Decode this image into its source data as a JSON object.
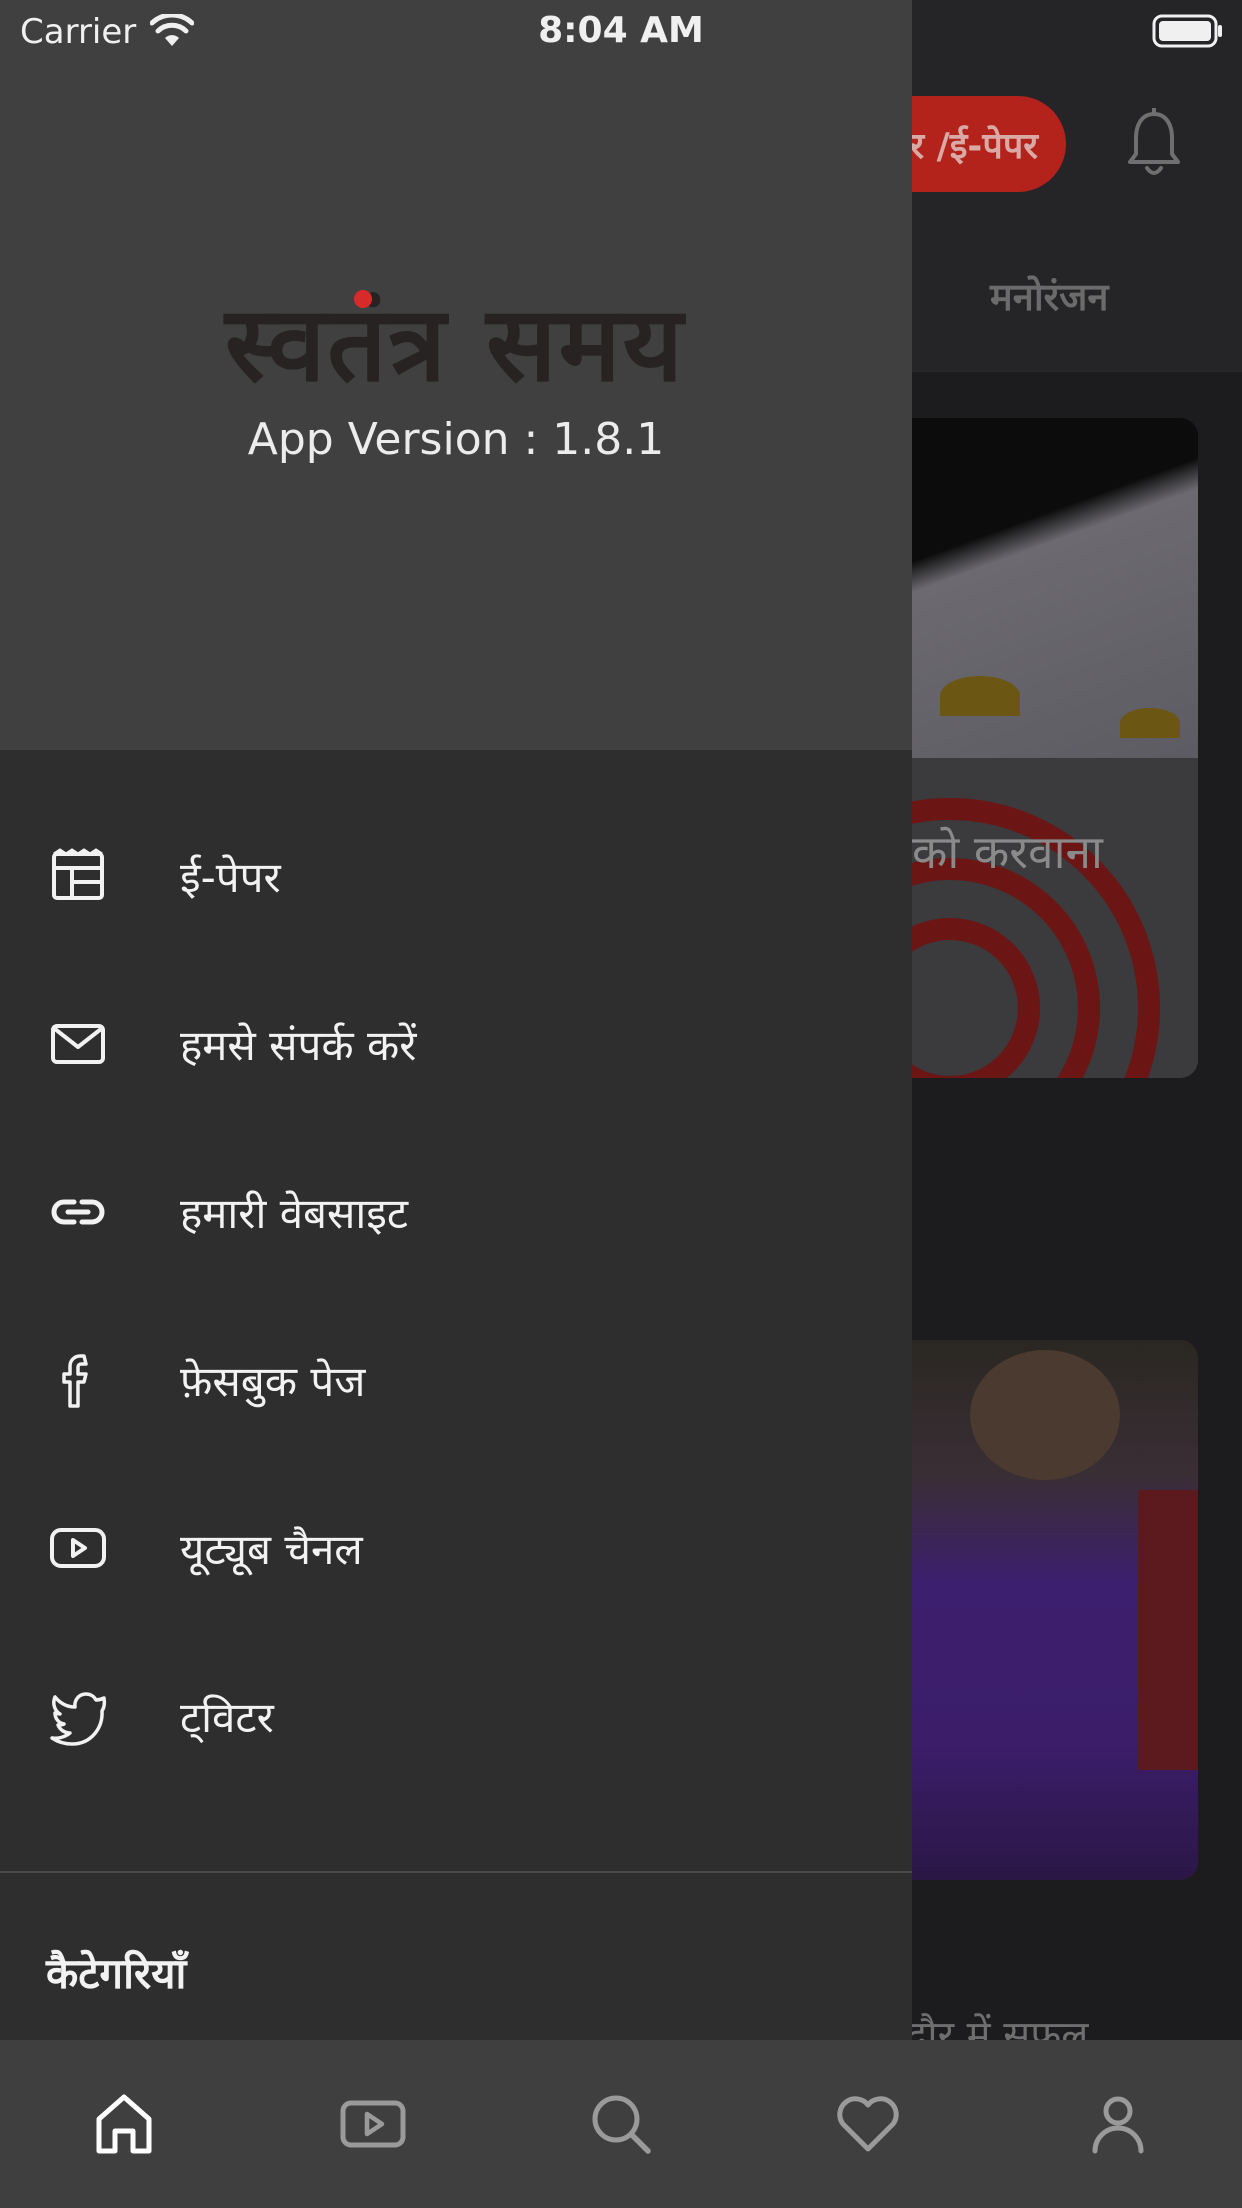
{
  "status_bar": {
    "carrier": "Carrier",
    "time": "8:04 AM"
  },
  "background": {
    "epaper_pill": "र /ई-पेपर",
    "tab_visible": "मनोरंजन",
    "card1_headline_fragment": "को करवाना",
    "card2_headline_fragment": "दौर में सफल"
  },
  "drawer": {
    "brand_name": "स्वतंत्र समय",
    "app_version": "App Version : 1.8.1",
    "menu": [
      {
        "label": "ई-पेपर",
        "icon": "newspaper-icon"
      },
      {
        "label": "हमसे संपर्क करें",
        "icon": "mail-icon"
      },
      {
        "label": "हमारी वेबसाइट",
        "icon": "link-icon"
      },
      {
        "label": "फ़ेसबुक पेज",
        "icon": "facebook-icon"
      },
      {
        "label": "यूट्यूब चैनल",
        "icon": "youtube-icon"
      },
      {
        "label": "ट्विटर",
        "icon": "twitter-icon"
      }
    ],
    "categories_heading": "कैटेगरियाँ"
  },
  "tabbar": {
    "tabs": [
      {
        "icon": "home-icon",
        "active": true
      },
      {
        "icon": "video-icon",
        "active": false
      },
      {
        "icon": "search-icon",
        "active": false
      },
      {
        "icon": "heart-icon",
        "active": false
      },
      {
        "icon": "profile-icon",
        "active": false
      }
    ]
  },
  "colors": {
    "drawer_bg": "#2e2e2f",
    "drawer_header_bg": "#404040",
    "accent_red": "#b3221b",
    "tabbar_bg": "#3f3f40"
  }
}
